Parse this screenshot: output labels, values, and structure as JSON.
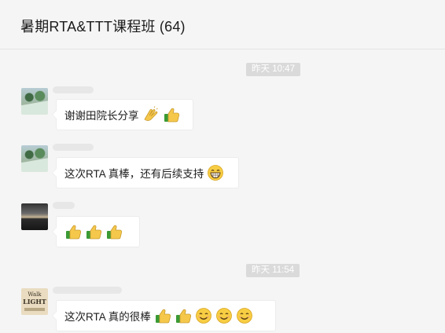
{
  "chat": {
    "title": "暑期RTA&TTT课程班 (64)"
  },
  "timestamps": [
    "昨天 10:47",
    "昨天 11:54"
  ],
  "messages": [
    {
      "text": "谢谢田院长分享",
      "emoji": [
        "clapping-hands-icon",
        "thumbs-up-icon"
      ],
      "avatar": "palm-avatar"
    },
    {
      "text": "这次RTA 真棒，还有后续支持",
      "emoji": [
        "grin-icon"
      ],
      "avatar": "palm-avatar"
    },
    {
      "text": "",
      "emoji": [
        "thumbs-up-icon",
        "thumbs-up-icon",
        "thumbs-up-icon"
      ],
      "avatar": "sunset-avatar"
    },
    {
      "text": "这次RTA 真的很棒",
      "emoji": [
        "thumbs-up-icon",
        "thumbs-up-icon",
        "smile-icon",
        "smile-icon",
        "smile-icon"
      ],
      "avatar": "walk-light-avatar"
    }
  ],
  "avatar_walk_light": {
    "line1": "Walk",
    "line2": "LIGHT"
  },
  "colors": {
    "background": "#f5f5f5",
    "bubble": "#ffffff",
    "timestamp_bg": "#dadada"
  }
}
